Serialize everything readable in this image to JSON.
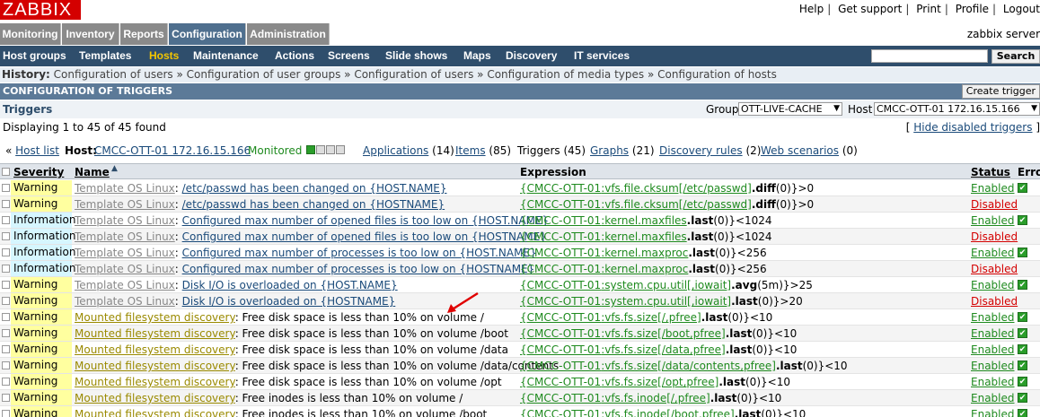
{
  "logo": "ZABBIX",
  "toplinks": [
    "Help",
    "Get support",
    "Print",
    "Profile",
    "Logout"
  ],
  "main_menu": {
    "items": [
      "Monitoring",
      "Inventory",
      "Reports",
      "Configuration",
      "Administration"
    ],
    "user": "zabbix server"
  },
  "sub_menu": {
    "items": [
      "Host groups",
      "Templates",
      "Hosts",
      "Maintenance",
      "Actions",
      "Screens",
      "Slide shows",
      "Maps",
      "Discovery",
      "IT services"
    ],
    "search_label": "Search"
  },
  "history": {
    "label": "History:",
    "crumbs": [
      "Configuration of users",
      "Configuration of user groups",
      "Configuration of users",
      "Configuration of media types",
      "Configuration of hosts"
    ]
  },
  "titlebar": {
    "title": "CONFIGURATION OF TRIGGERS",
    "create_label": "Create trigger"
  },
  "filter": {
    "title": "Triggers",
    "group_label": "Group",
    "group_value": "OTT-LIVE-CACHE",
    "host_label": "Host",
    "host_value": "CMCC-OTT-01 172.16.15.166",
    "displaying": "Displaying 1 to 45 of 45 found",
    "hide_disabled": "Hide disabled triggers"
  },
  "hostnav": {
    "host_list": "Host list",
    "host_label": "Host:",
    "host": "CMCC-OTT-01 172.16.15.166",
    "monitored": "Monitored",
    "applications": "Applications",
    "applications_count": "(14)",
    "items": "Items",
    "items_count": "(85)",
    "triggers": "Triggers (45)",
    "graphs": "Graphs",
    "graphs_count": "(21)",
    "discovery": "Discovery rules",
    "discovery_count": "(2)",
    "web": "Web scenarios",
    "web_count": "(0)"
  },
  "table": {
    "headers": {
      "severity": "Severity",
      "name": "Name",
      "expression": "Expression",
      "status": "Status",
      "error": "Error"
    },
    "rows": [
      {
        "severity": "Warning",
        "template": "Template OS Linux",
        "name": "/etc/passwd has been changed on {HOST.NAME}",
        "host": "{CMCC-OTT-01",
        "key": ":vfs.file.cksum[/etc/passwd]",
        "fn": ".diff",
        "rest": "(0)}>0",
        "status": "Enabled",
        "ok": true
      },
      {
        "severity": "Warning",
        "template": "Template OS Linux",
        "name": "/etc/passwd has been changed on {HOSTNAME}",
        "host": "{CMCC-OTT-01",
        "key": ":vfs.file.cksum[/etc/passwd]",
        "fn": ".diff",
        "rest": "(0)}>0",
        "status": "Disabled",
        "ok": false
      },
      {
        "severity": "Information",
        "template": "Template OS Linux",
        "name": "Configured max number of opened files is too low on {HOST.NAME}",
        "host": "{CMCC-OTT-01",
        "key": ":kernel.maxfiles",
        "fn": ".last",
        "rest": "(0)}<1024",
        "status": "Enabled",
        "ok": true
      },
      {
        "severity": "Information",
        "template": "Template OS Linux",
        "name": "Configured max number of opened files is too low on {HOSTNAME}",
        "host": "{CMCC-OTT-01",
        "key": ":kernel.maxfiles",
        "fn": ".last",
        "rest": "(0)}<1024",
        "status": "Disabled",
        "ok": false
      },
      {
        "severity": "Information",
        "template": "Template OS Linux",
        "name": "Configured max number of processes is too low on {HOST.NAME}",
        "host": "{CMCC-OTT-01",
        "key": ":kernel.maxproc",
        "fn": ".last",
        "rest": "(0)}<256",
        "status": "Enabled",
        "ok": true
      },
      {
        "severity": "Information",
        "template": "Template OS Linux",
        "name": "Configured max number of processes is too low on {HOSTNAME}",
        "host": "{CMCC-OTT-01",
        "key": ":kernel.maxproc",
        "fn": ".last",
        "rest": "(0)}<256",
        "status": "Disabled",
        "ok": false
      },
      {
        "severity": "Warning",
        "template": "Template OS Linux",
        "name": "Disk I/O is overloaded on {HOST.NAME}",
        "host": "{CMCC-OTT-01",
        "key": ":system.cpu.util[,iowait]",
        "fn": ".avg",
        "rest": "(5m)}>25",
        "status": "Enabled",
        "ok": true
      },
      {
        "severity": "Warning",
        "template": "Template OS Linux",
        "name": "Disk I/O is overloaded on {HOSTNAME}",
        "host": "{CMCC-OTT-01",
        "key": ":system.cpu.util[,iowait]",
        "fn": ".last",
        "rest": "(0)}>20",
        "status": "Disabled",
        "ok": false
      },
      {
        "severity": "Warning",
        "template": "Mounted filesystem discovery",
        "name": "Free disk space is less than 10% on volume /",
        "plain": true,
        "host": "{CMCC-OTT-01",
        "key": ":vfs.fs.size[/,pfree]",
        "fn": ".last",
        "rest": "(0)}<10",
        "status": "Enabled",
        "ok": true
      },
      {
        "severity": "Warning",
        "template": "Mounted filesystem discovery",
        "name": "Free disk space is less than 10% on volume /boot",
        "plain": true,
        "host": "{CMCC-OTT-01",
        "key": ":vfs.fs.size[/boot,pfree]",
        "fn": ".last",
        "rest": "(0)}<10",
        "status": "Enabled",
        "ok": true
      },
      {
        "severity": "Warning",
        "template": "Mounted filesystem discovery",
        "name": "Free disk space is less than 10% on volume /data",
        "plain": true,
        "host": "{CMCC-OTT-01",
        "key": ":vfs.fs.size[/data,pfree]",
        "fn": ".last",
        "rest": "(0)}<10",
        "status": "Enabled",
        "ok": true
      },
      {
        "severity": "Warning",
        "template": "Mounted filesystem discovery",
        "name": "Free disk space is less than 10% on volume /data/contents",
        "plain": true,
        "host": "{CMCC-OTT-01",
        "key": ":vfs.fs.size[/data/contents,pfree]",
        "fn": ".last",
        "rest": "(0)}<10",
        "status": "Enabled",
        "ok": true
      },
      {
        "severity": "Warning",
        "template": "Mounted filesystem discovery",
        "name": "Free disk space is less than 10% on volume /opt",
        "plain": true,
        "host": "{CMCC-OTT-01",
        "key": ":vfs.fs.size[/opt,pfree]",
        "fn": ".last",
        "rest": "(0)}<10",
        "status": "Enabled",
        "ok": true
      },
      {
        "severity": "Warning",
        "template": "Mounted filesystem discovery",
        "name": "Free inodes is less than 10% on volume /",
        "plain": true,
        "host": "{CMCC-OTT-01",
        "key": ":vfs.fs.inode[/,pfree]",
        "fn": ".last",
        "rest": "(0)}<10",
        "status": "Enabled",
        "ok": true
      },
      {
        "severity": "Warning",
        "template": "Mounted filesystem discovery",
        "name": "Free inodes is less than 10% on volume /boot",
        "plain": true,
        "host": "{CMCC-OTT-01",
        "key": ":vfs.fs.inode[/boot,pfree]",
        "fn": ".last",
        "rest": "(0)}<10",
        "status": "Enabled",
        "ok": true
      }
    ]
  },
  "colors": {
    "warning": "#ffff9f",
    "information": "#d6f6ff",
    "enabled": "#1e8a1e",
    "disabled": "#d40000"
  }
}
